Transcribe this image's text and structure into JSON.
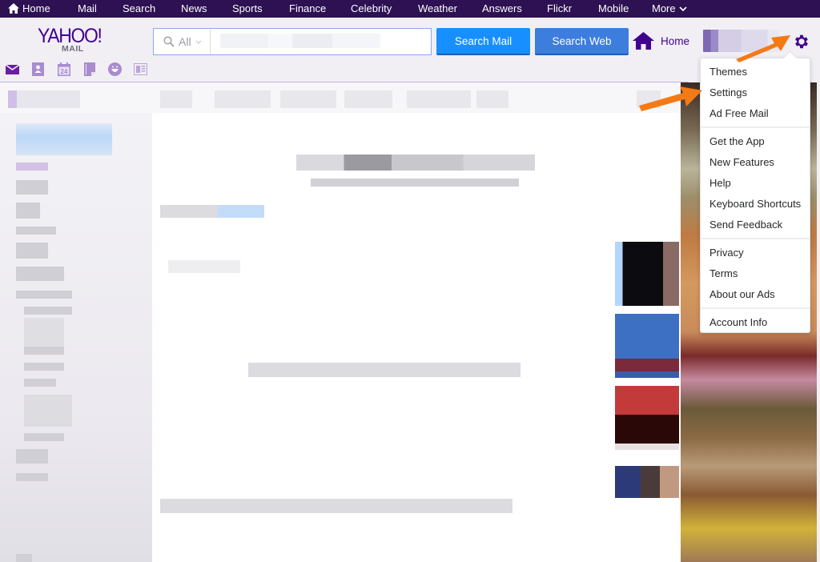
{
  "topnav": {
    "items": [
      {
        "label": "Home",
        "icon": "home-icon"
      },
      {
        "label": "Mail"
      },
      {
        "label": "Search"
      },
      {
        "label": "News"
      },
      {
        "label": "Sports"
      },
      {
        "label": "Finance"
      },
      {
        "label": "Celebrity"
      },
      {
        "label": "Weather"
      },
      {
        "label": "Answers"
      },
      {
        "label": "Flickr"
      },
      {
        "label": "Mobile"
      },
      {
        "label": "More",
        "icon": "chevron-down-icon"
      }
    ]
  },
  "logo": {
    "brand": "YAHOO!",
    "product": "MAIL"
  },
  "search": {
    "scope": "All",
    "scope_icon": "search-icon",
    "value": "",
    "search_mail_label": "Search Mail",
    "search_web_label": "Search Web"
  },
  "header": {
    "home_label": "Home",
    "settings_icon": "gear-icon"
  },
  "apps": [
    {
      "name": "mail",
      "icon": "envelope-icon"
    },
    {
      "name": "contacts",
      "icon": "contacts-icon"
    },
    {
      "name": "calendar",
      "icon": "calendar-icon",
      "label": "24"
    },
    {
      "name": "notepad",
      "icon": "notepad-icon"
    },
    {
      "name": "messenger",
      "icon": "smiley-icon"
    },
    {
      "name": "newsfeed",
      "icon": "newsfeed-icon"
    }
  ],
  "settings_menu": {
    "groups": [
      [
        "Themes",
        "Settings",
        "Ad Free Mail"
      ],
      [
        "Get the App",
        "New Features",
        "Help",
        "Keyboard Shortcuts",
        "Send Feedback"
      ],
      [
        "Privacy",
        "Terms",
        "About our Ads"
      ],
      [
        "Account Info"
      ]
    ],
    "highlighted": "Settings"
  },
  "colors": {
    "nav_bg": "#2d1152",
    "brand_purple": "#400090",
    "search_mail_btn": "#188fff",
    "search_web_btn": "#3d7ddd",
    "annotation_arrow": "#f47a16"
  }
}
